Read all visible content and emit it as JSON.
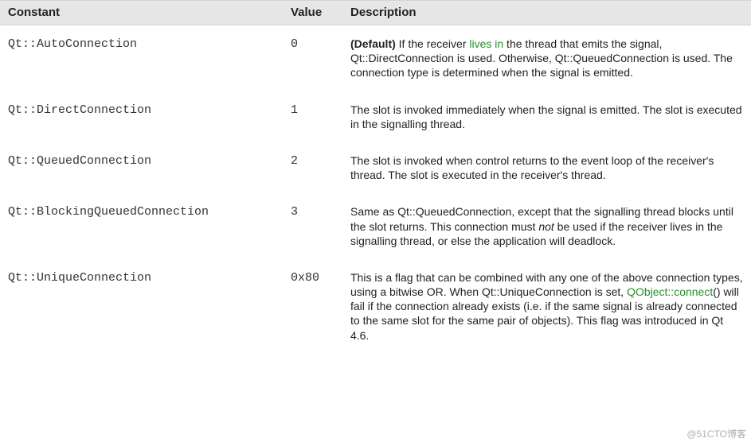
{
  "columns": {
    "constant": "Constant",
    "value": "Value",
    "description": "Description"
  },
  "rows": [
    {
      "constant": "Qt::AutoConnection",
      "value": "0",
      "desc_prefix_bold": "(Default)",
      "desc_before_link": " If the receiver ",
      "link_text": "lives in",
      "desc_after_link": " the thread that emits the signal, Qt::DirectConnection is used. Otherwise, Qt::QueuedConnection is used. The connection type is determined when the signal is emitted."
    },
    {
      "constant": "Qt::DirectConnection",
      "value": "1",
      "desc_plain": "The slot is invoked immediately when the signal is emitted. The slot is executed in the signalling thread."
    },
    {
      "constant": "Qt::QueuedConnection",
      "value": "2",
      "desc_plain": "The slot is invoked when control returns to the event loop of the receiver's thread. The slot is executed in the receiver's thread."
    },
    {
      "constant": "Qt::BlockingQueuedConnection",
      "value": "3",
      "desc_before_italic": "Same as Qt::QueuedConnection, except that the signalling thread blocks until the slot returns. This connection must ",
      "italic_text": "not",
      "desc_after_italic": " be used if the receiver lives in the signalling thread, or else the application will deadlock."
    },
    {
      "constant": "Qt::UniqueConnection",
      "value": "0x80",
      "desc_before_link2": "This is a flag that can be combined with any one of the above connection types, using a bitwise OR. When Qt::UniqueConnection is set, ",
      "link2_text": "QObject::connect",
      "desc_after_link2": "() will fail if the connection already exists (i.e. if the same signal is already connected to the same slot for the same pair of objects). This flag was introduced in Qt 4.6."
    }
  ],
  "watermark": "@51CTO博客"
}
